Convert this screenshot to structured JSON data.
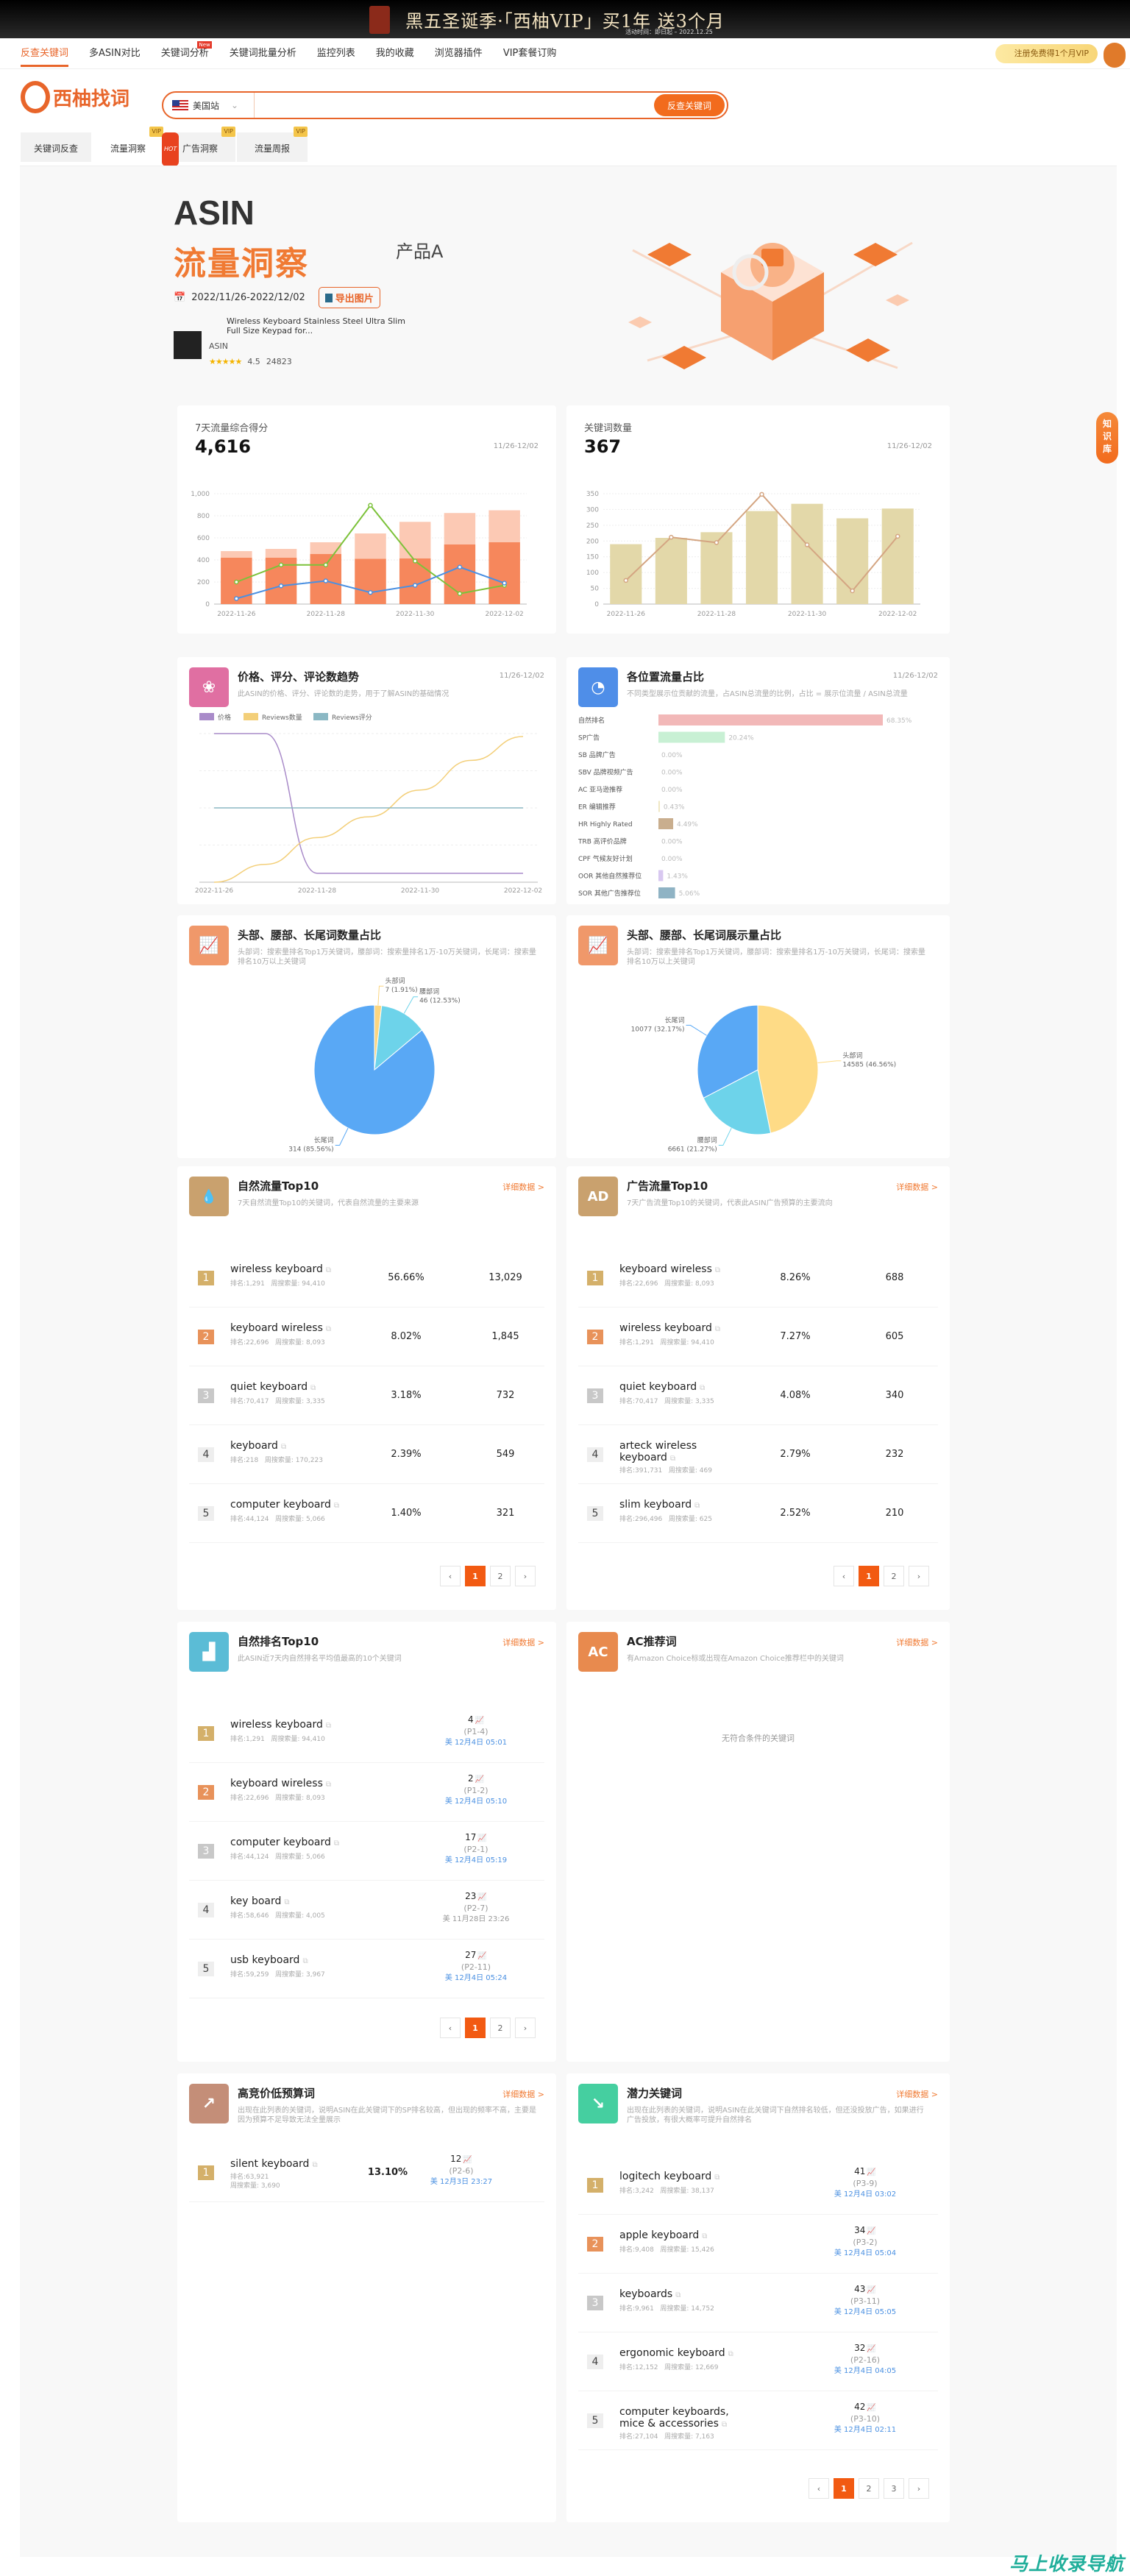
{
  "banner": {
    "title": "黑五圣诞季·「西柚VIP」买1年 送3个月",
    "subtitle": "活动时间：即日起 – 2022.12.25"
  },
  "nav": {
    "items": [
      "反查关键词",
      "多ASIN对比",
      "关键词分析",
      "关键词批量分析",
      "监控列表",
      "我的收藏",
      "浏览器插件",
      "VIP套餐订购"
    ],
    "new_badge": "New",
    "vip_button": "注册免费得1个月VIP"
  },
  "logo": {
    "name": "西柚找词"
  },
  "search": {
    "site": "美国站",
    "value": "",
    "button": "反查关键词"
  },
  "tabs": [
    {
      "label": "关键词反查",
      "badge": ""
    },
    {
      "label": "流量洞察",
      "badge": "VIP"
    },
    {
      "label": "广告洞察",
      "badge": "VIP",
      "hot": "HOT"
    },
    {
      "label": "流量周报",
      "badge": "VIP"
    }
  ],
  "hero": {
    "asin": "ASIN",
    "title": "流量洞察",
    "product": "产品A",
    "date_range": "2022/11/26-2022/12/02",
    "export": "导出图片",
    "item_name": "Wireless Keyboard Stainless Steel Ultra Slim Full Size Keypad for...",
    "asin_label": "ASIN",
    "rating": "4.5",
    "reviews": "24823",
    "stars": "★★★★★"
  },
  "side": {
    "knowledge": "知识库"
  },
  "watermark": "马上收录导航",
  "colors": {
    "accent": "#f07a33",
    "orange_dark": "#f6875c",
    "orange_light": "#fcc9b4",
    "green_line": "#7cc23a",
    "blue_line": "#4a90e2",
    "beige": "#e3d8a9",
    "beige_line": "#d4a582"
  },
  "score_card": {
    "title": "7天流量综合得分",
    "value": "4,616",
    "range": "11/26-12/02"
  },
  "keyword_card": {
    "title": "关键词数量",
    "value": "367",
    "range": "11/26-12/02"
  },
  "trend_card": {
    "title": "价格、评分、评论数趋势",
    "desc": "此ASIN的价格、评分、评论数的走势，用于了解ASIN的基础情况",
    "range": "11/26-12/02"
  },
  "position_card": {
    "title": "各位置流量占比",
    "desc": "不同类型展示位贡献的流量，占ASIN总流量的比例，占比 = 展示位流量 / ASIN总流量",
    "range": "11/26-12/02"
  },
  "count_pie_card": {
    "title": "头部、腰部、长尾词数量占比",
    "desc": "头部词：搜索量排名Top1万关键词，腰部词：搜索量排名1万-10万关键词，长尾词：搜索量排名10万以上关键词"
  },
  "impr_pie_card": {
    "title": "头部、腰部、长尾词展示量占比",
    "desc": "头部词：搜索量排名Top1万关键词，腰部词：搜索量排名1万-10万关键词，长尾词：搜索量排名10万以上关键词"
  },
  "chart_data": [
    {
      "type": "bar",
      "stacked": true,
      "categories": [
        "2022-11-26",
        "2022-11-27",
        "2022-11-28",
        "2022-11-29",
        "2022-11-30",
        "2022-12-01",
        "2022-12-02"
      ],
      "tick_labels": [
        "2022-11-26",
        "2022-11-28",
        "2022-11-30",
        "2022-12-02"
      ],
      "ylim": [
        0,
        1000
      ],
      "yticks": [
        "0",
        "200",
        "400",
        "600",
        "800",
        "1,000"
      ],
      "grid": true,
      "series": [
        {
          "kind": "bar",
          "color": "#f6875c",
          "values": [
            420,
            420,
            455,
            410,
            415,
            540,
            560
          ]
        },
        {
          "kind": "bar",
          "color": "#fcc9b4",
          "values": [
            60,
            80,
            105,
            230,
            330,
            285,
            290
          ]
        },
        {
          "kind": "line",
          "color": "#7cc23a",
          "values": [
            200,
            355,
            355,
            895,
            390,
            95,
            170
          ]
        },
        {
          "kind": "line",
          "color": "#4a90e2",
          "values": [
            50,
            165,
            210,
            105,
            170,
            335,
            190
          ]
        }
      ]
    },
    {
      "type": "bar",
      "categories": [
        "2022-11-26",
        "2022-11-27",
        "2022-11-28",
        "2022-11-29",
        "2022-11-30",
        "2022-12-01",
        "2022-12-02"
      ],
      "tick_labels": [
        "2022-11-26",
        "2022-11-28",
        "2022-11-30",
        "2022-12-02"
      ],
      "ylim": [
        0,
        350
      ],
      "yticks": [
        "0",
        "50",
        "100",
        "150",
        "200",
        "250",
        "300",
        "350"
      ],
      "grid": true,
      "series": [
        {
          "kind": "bar",
          "color": "#e3d8a9",
          "values": [
            190,
            210,
            228,
            295,
            318,
            272,
            303
          ]
        },
        {
          "kind": "line",
          "color": "#d4a582",
          "values": [
            75,
            212,
            195,
            348,
            188,
            42,
            215
          ]
        }
      ]
    },
    {
      "type": "line",
      "categories": [
        "2022-11-26",
        "2022-11-27",
        "2022-11-28",
        "2022-11-29",
        "2022-11-30",
        "2022-12-01",
        "2022-12-02"
      ],
      "tick_labels": [
        "2022-11-26",
        "2022-11-28",
        "2022-11-30",
        "2022-12-02"
      ],
      "legend": "top-left",
      "grid": true,
      "series": [
        {
          "name": "价格",
          "color": "#a98bc9",
          "values": [
            100,
            100,
            6,
            6,
            6,
            6,
            6
          ]
        },
        {
          "name": "Reviews数量",
          "color": "#f3cf79",
          "values": [
            0,
            12,
            30,
            44,
            62,
            82,
            98
          ]
        },
        {
          "name": "Reviews评分",
          "color": "#8bb8c4",
          "values": [
            50,
            50,
            50,
            50,
            50,
            50,
            50
          ]
        }
      ]
    },
    {
      "type": "bar",
      "orientation": "horizontal",
      "categories": [
        "自然排名",
        "SP广告",
        "SB 品牌广告",
        "SBV 品牌视频广告",
        "AC 亚马逊推荐",
        "ER 编辑推荐",
        "HR Highly Rated",
        "TRB 高评价品牌",
        "CPF 气候友好计划",
        "OOR 其他自然推荐位",
        "SOR 其他广告推荐位"
      ],
      "values": [
        68.35,
        20.24,
        0,
        0,
        0,
        0.43,
        4.49,
        0,
        0,
        1.43,
        5.06
      ],
      "labels": [
        "68.35%",
        "20.24%",
        "0.00%",
        "0.00%",
        "0.00%",
        "0.43%",
        "4.49%",
        "0.00%",
        "0.00%",
        "1.43%",
        "5.06%"
      ],
      "colors": [
        "#f2b8b8",
        "#c8f0d4",
        "#ccc",
        "#ccc",
        "#ccc",
        "#efe6c0",
        "#c9ae8e",
        "#ccc",
        "#ccc",
        "#d8c8f0",
        "#8fb3c4"
      ]
    },
    {
      "type": "pie",
      "slices": [
        {
          "name": "头部词",
          "value": 7,
          "label": "7 (1.91%)",
          "color": "#fbd681"
        },
        {
          "name": "腰部词",
          "value": 46,
          "label": "46 (12.53%)",
          "color": "#6dd3ea"
        },
        {
          "name": "长尾词",
          "value": 314,
          "label": "314 (85.56%)",
          "color": "#59a8f5"
        }
      ]
    },
    {
      "type": "pie",
      "slices": [
        {
          "name": "头部词",
          "value": 14585,
          "label": "14585 (46.56%)",
          "color": "#fedb86"
        },
        {
          "name": "腰部词",
          "value": 6661,
          "label": "6661 (21.27%)",
          "color": "#6dd3ea"
        },
        {
          "name": "长尾词",
          "value": 10077,
          "label": "10077 (32.17%)",
          "color": "#59a8f5"
        }
      ]
    }
  ],
  "lists": [
    {
      "title": "自然流量Top10",
      "desc": "7天自然流量Top10的关键词，代表自然流量的主要来源",
      "more": "详细数据 >",
      "icon": "droplet-icon",
      "icon_glyph": "💧",
      "icon_color": "#c9a16e",
      "type": "traffic",
      "pages": [
        "‹",
        "1",
        "2",
        "›"
      ],
      "rows": [
        {
          "kw": "wireless keyboard",
          "rank": "排名:1,291",
          "vol": "周搜索量: 94,410",
          "pct": "56.66%",
          "val": "13,029"
        },
        {
          "kw": "keyboard wireless",
          "rank": "排名:22,696",
          "vol": "周搜索量: 8,093",
          "pct": "8.02%",
          "val": "1,845"
        },
        {
          "kw": "quiet keyboard",
          "rank": "排名:70,417",
          "vol": "周搜索量: 3,335",
          "pct": "3.18%",
          "val": "732"
        },
        {
          "kw": "keyboard",
          "rank": "排名:218",
          "vol": "周搜索量: 170,223",
          "pct": "2.39%",
          "val": "549"
        },
        {
          "kw": "computer keyboard",
          "rank": "排名:44,124",
          "vol": "周搜索量: 5,066",
          "pct": "1.40%",
          "val": "321"
        }
      ]
    },
    {
      "title": "广告流量Top10",
      "desc": "7天广告流量Top10的关键词，代表此ASIN广告预算的主要流向",
      "more": "详细数据 >",
      "icon": "ad-icon",
      "icon_glyph": "AD",
      "icon_color": "#c9a16e",
      "type": "traffic",
      "pages": [
        "‹",
        "1",
        "2",
        "›"
      ],
      "rows": [
        {
          "kw": "keyboard wireless",
          "rank": "排名:22,696",
          "vol": "周搜索量: 8,093",
          "pct": "8.26%",
          "val": "688"
        },
        {
          "kw": "wireless keyboard",
          "rank": "排名:1,291",
          "vol": "周搜索量: 94,410",
          "pct": "7.27%",
          "val": "605"
        },
        {
          "kw": "quiet keyboard",
          "rank": "排名:70,417",
          "vol": "周搜索量: 3,335",
          "pct": "4.08%",
          "val": "340"
        },
        {
          "kw": "arteck wireless keyboard",
          "rank": "排名:391,731",
          "vol": "周搜索量: 469",
          "pct": "2.79%",
          "val": "232"
        },
        {
          "kw": "slim keyboard",
          "rank": "排名:296,496",
          "vol": "周搜索量: 625",
          "pct": "2.52%",
          "val": "210"
        }
      ]
    },
    {
      "title": "自然排名Top10",
      "desc": "此ASIN近7天内自然排名平均值最高的10个关键词",
      "more": "详细数据 >",
      "icon": "bar-chart-icon",
      "icon_glyph": "▟",
      "icon_color": "#5bbcd6",
      "type": "ranking",
      "pages": [
        "‹",
        "1",
        "2",
        "›"
      ],
      "rows": [
        {
          "kw": "wireless keyboard",
          "rank": "排名:1,291",
          "vol": "周搜索量: 94,410",
          "pos": "4",
          "page": "(P1-4)",
          "time": "美 12月4日 05:01"
        },
        {
          "kw": "keyboard wireless",
          "rank": "排名:22,696",
          "vol": "周搜索量: 8,093",
          "pos": "2",
          "page": "(P1-2)",
          "time": "美 12月4日 05:10"
        },
        {
          "kw": "computer keyboard",
          "rank": "排名:44,124",
          "vol": "周搜索量: 5,066",
          "pos": "17",
          "page": "(P2-1)",
          "time": "美 12月4日 05:19"
        },
        {
          "kw": "key board",
          "rank": "排名:58,646",
          "vol": "周搜索量: 4,005",
          "pos": "23",
          "page": "(P2-7)",
          "time": "美 11月28日 23:26",
          "stale": true
        },
        {
          "kw": "usb keyboard",
          "rank": "排名:59,259",
          "vol": "周搜索量: 3,967",
          "pos": "27",
          "page": "(P2-11)",
          "time": "美 12月4日 05:24"
        }
      ]
    },
    {
      "title": "AC推荐词",
      "desc": "有Amazon Choice标或出现在Amazon Choice推荐栏中的关键词",
      "more": "详细数据 >",
      "icon": "ac-icon",
      "icon_glyph": "AC",
      "icon_color": "#e88a4e",
      "type": "empty",
      "empty": "无符合条件的关键词",
      "rows": []
    },
    {
      "title": "高竞价低预算词",
      "desc": "出现在此列表的关键词，说明ASIN在此关键词下的SP排名较高，但出现的频率不高，主要是因为预算不足导致无法全量展示",
      "more": "详细数据 >",
      "icon": "trend-up-icon",
      "icon_glyph": "↗",
      "icon_color": "#c48e78",
      "type": "bid",
      "rows": [
        {
          "kw": "silent keyboard",
          "rank": "排名:63,921",
          "vol": "周搜索量: 3,690",
          "pct": "13.10%",
          "pos": "12",
          "page": "(P2-6)",
          "time": "美 12月3日 23:27"
        }
      ]
    },
    {
      "title": "潜力关键词",
      "desc": "出现在此列表的关键词，说明ASIN在此关键词下自然排名较低，但还没投放广告，如果进行广告投放，有很大概率可提升自然排名",
      "more": "详细数据 >",
      "icon": "trend-down-icon",
      "icon_glyph": "↘",
      "icon_color": "#45cfa0",
      "type": "ranking",
      "pages": [
        "‹",
        "1",
        "2",
        "3",
        "›"
      ],
      "rows": [
        {
          "kw": "logitech keyboard",
          "rank": "排名:3,242",
          "vol": "周搜索量: 38,137",
          "pos": "41",
          "page": "(P3-9)",
          "time": "美 12月4日 03:02"
        },
        {
          "kw": "apple keyboard",
          "rank": "排名:9,408",
          "vol": "周搜索量: 15,426",
          "pos": "34",
          "page": "(P3-2)",
          "time": "美 12月4日 05:04"
        },
        {
          "kw": "keyboards",
          "rank": "排名:9,961",
          "vol": "周搜索量: 14,752",
          "pos": "43",
          "page": "(P3-11)",
          "time": "美 12月4日 05:05"
        },
        {
          "kw": "ergonomic keyboard",
          "rank": "排名:12,152",
          "vol": "周搜索量: 12,669",
          "pos": "32",
          "page": "(P2-16)",
          "time": "美 12月4日 04:05"
        },
        {
          "kw": "computer keyboards, mice & accessories",
          "rank": "排名:27,104",
          "vol": "周搜索量: 7,163",
          "pos": "42",
          "page": "(P3-10)",
          "time": "美 12月4日 02:11"
        }
      ]
    }
  ]
}
